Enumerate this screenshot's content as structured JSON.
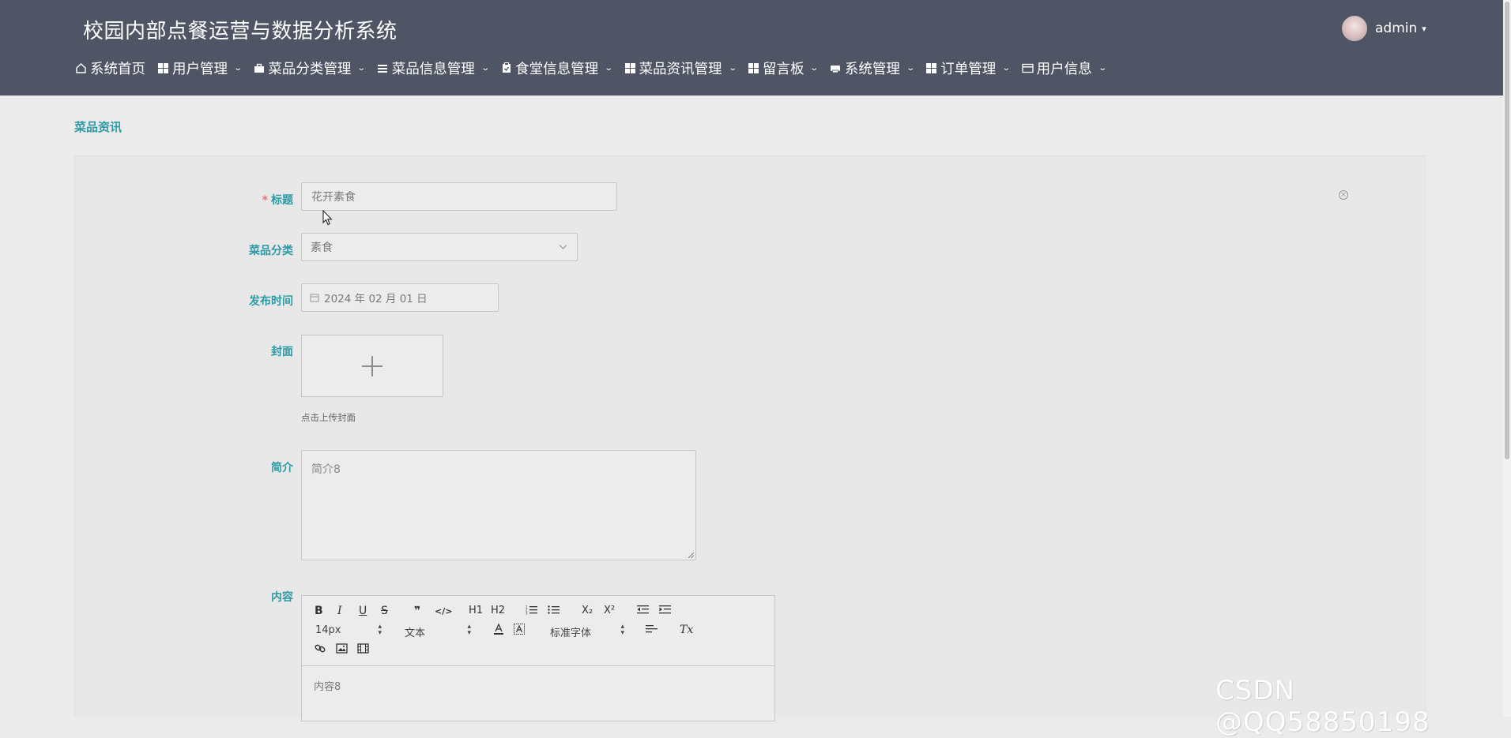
{
  "app": {
    "title": "校园内部点餐运营与数据分析系统"
  },
  "user": {
    "name": "admin"
  },
  "nav": {
    "items": [
      {
        "label": "系统首页",
        "icon": "home-icon",
        "has_dropdown": false
      },
      {
        "label": "用户管理",
        "icon": "grid-icon",
        "has_dropdown": true
      },
      {
        "label": "菜品分类管理",
        "icon": "briefcase-icon",
        "has_dropdown": true
      },
      {
        "label": "菜品信息管理",
        "icon": "list-icon",
        "has_dropdown": true
      },
      {
        "label": "食堂信息管理",
        "icon": "clipboard-icon",
        "has_dropdown": true
      },
      {
        "label": "菜品资讯管理",
        "icon": "grid-icon",
        "has_dropdown": true
      },
      {
        "label": "留言板",
        "icon": "grid-icon",
        "has_dropdown": true
      },
      {
        "label": "系统管理",
        "icon": "printer-icon",
        "has_dropdown": true
      },
      {
        "label": "订单管理",
        "icon": "grid-icon",
        "has_dropdown": true
      },
      {
        "label": "用户信息",
        "icon": "card-icon",
        "has_dropdown": true
      }
    ]
  },
  "page": {
    "breadcrumb": "菜品资讯"
  },
  "form": {
    "title_label": "标题",
    "title_required_mark": "*",
    "title_value": "花开素食",
    "category_label": "菜品分类",
    "category_value": "素食",
    "date_label": "发布时间",
    "date_value": "2024 年 02 月 01 日",
    "cover_label": "封面",
    "cover_tip": "点击上传封面",
    "summary_label": "简介",
    "summary_value": "简介8",
    "content_label": "内容",
    "content_value": "内容8"
  },
  "editor": {
    "bold": "B",
    "italic": "I",
    "underline": "U",
    "strike": "S",
    "quote": "❞",
    "code": "</>",
    "h1": "H1",
    "h2": "H2",
    "sub": "X₂",
    "sup": "X²",
    "font_size": "14px",
    "header_select": "文本",
    "font_family": "标准字体",
    "clear_format": "Tx"
  },
  "watermark": "CSDN @QQ58850198",
  "colors": {
    "header_bg": "#4f5564",
    "accent": "#2e9aa6",
    "page_bg": "#ebebeb",
    "required": "#f56c6c"
  }
}
